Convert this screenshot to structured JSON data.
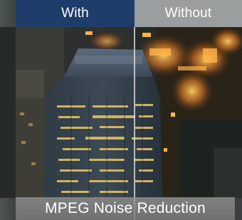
{
  "comparison": {
    "left_label": "With",
    "right_label": "Without",
    "caption": "MPEG Noise Reduction"
  },
  "colors": {
    "left_tab_bg": "#1f3d6a",
    "right_tab_bg": "#9a9e9e",
    "caption_bg": "#8e908f",
    "label_text": "#ffffff"
  }
}
